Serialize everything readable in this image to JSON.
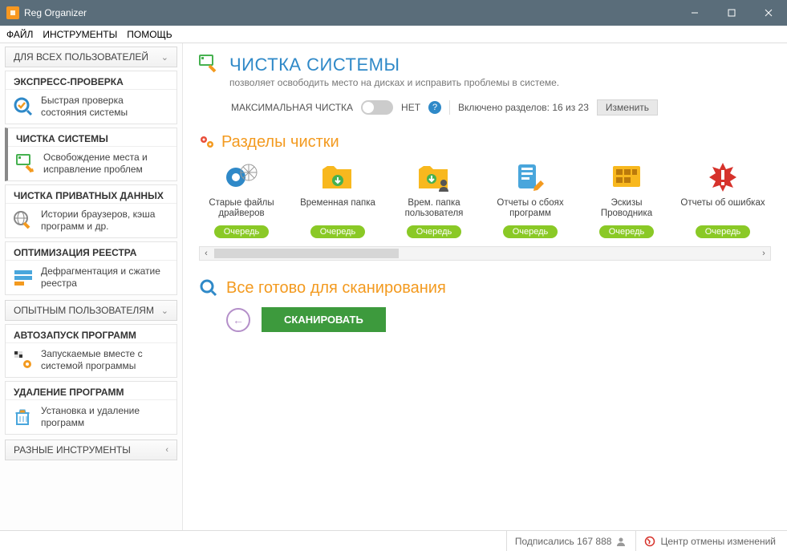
{
  "window": {
    "title": "Reg Organizer"
  },
  "menus": {
    "file": "ФАЙЛ",
    "tools": "ИНСТРУМЕНТЫ",
    "help": "ПОМОЩЬ"
  },
  "sidebar": {
    "group_all": "ДЛЯ ВСЕХ ПОЛЬЗОВАТЕЛЕЙ",
    "group_adv": "ОПЫТНЫМ ПОЛЬЗОВАТЕЛЯМ",
    "group_misc": "РАЗНЫЕ ИНСТРУМЕНТЫ",
    "cards": {
      "express": {
        "title": "ЭКСПРЕСС-ПРОВЕРКА",
        "desc": "Быстрая проверка состояния системы"
      },
      "clean": {
        "title": "ЧИСТКА СИСТЕМЫ",
        "desc": "Освобождение места и исправление проблем"
      },
      "privacy": {
        "title": "ЧИСТКА ПРИВАТНЫХ ДАННЫХ",
        "desc": "Истории браузеров, кэша программ и др."
      },
      "registry": {
        "title": "ОПТИМИЗАЦИЯ РЕЕСТРА",
        "desc": "Дефрагментация и сжатие реестра"
      },
      "startup": {
        "title": "АВТОЗАПУСК ПРОГРАММ",
        "desc": "Запускаемые вместе с системой программы"
      },
      "uninst": {
        "title": "УДАЛЕНИЕ ПРОГРАММ",
        "desc": "Установка и удаление программ"
      }
    }
  },
  "page": {
    "title": "ЧИСТКА СИСТЕМЫ",
    "subtitle": "позволяет освободить место на дисках и исправить проблемы в системе.",
    "maxclean_label": "МАКСИМАЛЬНАЯ ЧИСТКА",
    "maxclean_state": "НЕТ",
    "sections_enabled": "Включено разделов: 16 из 23",
    "change_btn": "Изменить",
    "sections_title": "Разделы чистки",
    "queue_label": "Очередь",
    "tiles": [
      {
        "label": "Старые файлы драйверов"
      },
      {
        "label": "Временная папка"
      },
      {
        "label": "Врем. папка пользователя"
      },
      {
        "label": "Отчеты о сбоях программ"
      },
      {
        "label": "Эскизы Проводника"
      },
      {
        "label": "Отчеты об ошибках"
      }
    ],
    "ready_title": "Все готово для сканирования",
    "scan_btn": "СКАНИРОВАТЬ"
  },
  "status": {
    "subscribers": "Подписались 167 888",
    "undo": "Центр отмены изменений"
  }
}
